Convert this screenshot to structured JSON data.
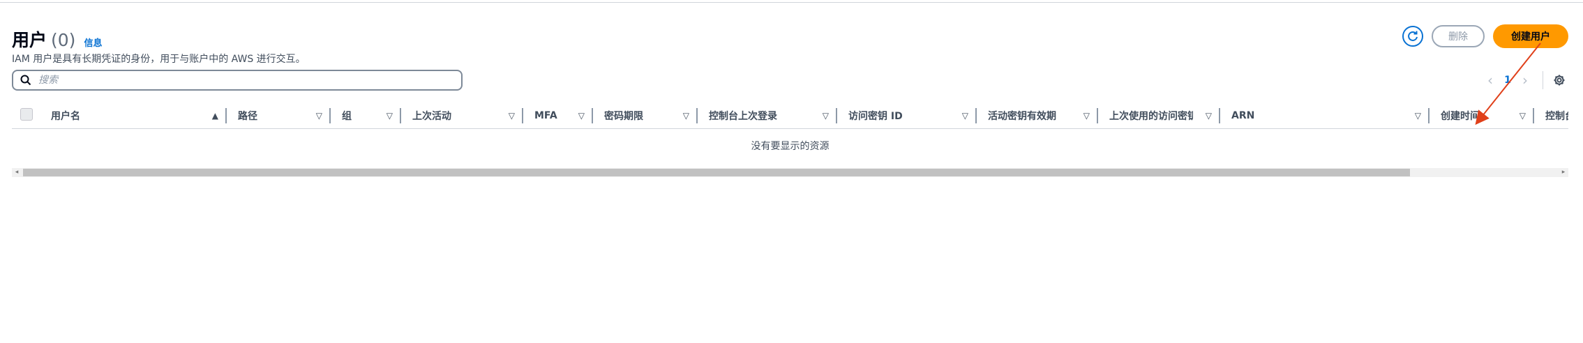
{
  "header": {
    "title": "用户",
    "count": "(0)",
    "info_link": "信息",
    "subtitle": "IAM 用户是具有长期凭证的身份，用于与账户中的 AWS 进行交互。"
  },
  "actions": {
    "delete_label": "删除",
    "create_label": "创建用户"
  },
  "search": {
    "placeholder": "搜索"
  },
  "pagination": {
    "current_page": "1"
  },
  "table": {
    "columns": [
      {
        "label": "用户名",
        "sorted": "ascending"
      },
      {
        "label": "路径"
      },
      {
        "label": "组"
      },
      {
        "label": "上次活动"
      },
      {
        "label": "MFA"
      },
      {
        "label": "密码期限"
      },
      {
        "label": "控制台上次登录"
      },
      {
        "label": "访问密钥 ID"
      },
      {
        "label": "活动密钥有效期"
      },
      {
        "label": "上次使用的访问密钥"
      },
      {
        "label": "ARN"
      },
      {
        "label": "创建时间"
      },
      {
        "label": "控制台访问"
      }
    ],
    "empty_message": "没有要显示的资源"
  },
  "colors": {
    "primary_button": "#ff9900",
    "link": "#0972d3",
    "annotation_arrow": "#e0401a"
  }
}
